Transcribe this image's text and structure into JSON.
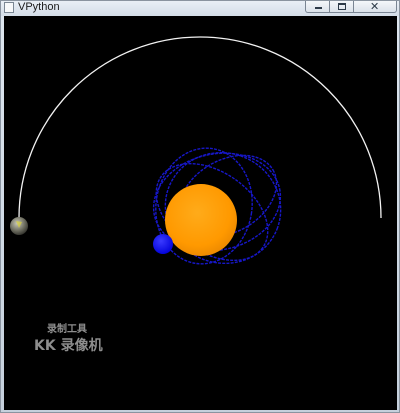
{
  "window": {
    "title": "VPython",
    "close_glyph": "✕"
  },
  "icons": {
    "app": "vpython-app-icon",
    "minimize": "minimize-icon",
    "maximize": "maximize-icon",
    "close": "close-icon"
  },
  "scene": {
    "background_color": "#000000",
    "sun_color": "#ff9900",
    "planet_color": "#0a0aff",
    "orbit_trail_color": "#1a1ad0",
    "arc_color": "#ffffff"
  },
  "watermark": {
    "line1": "录制工具",
    "line2": "KK 录像机"
  }
}
